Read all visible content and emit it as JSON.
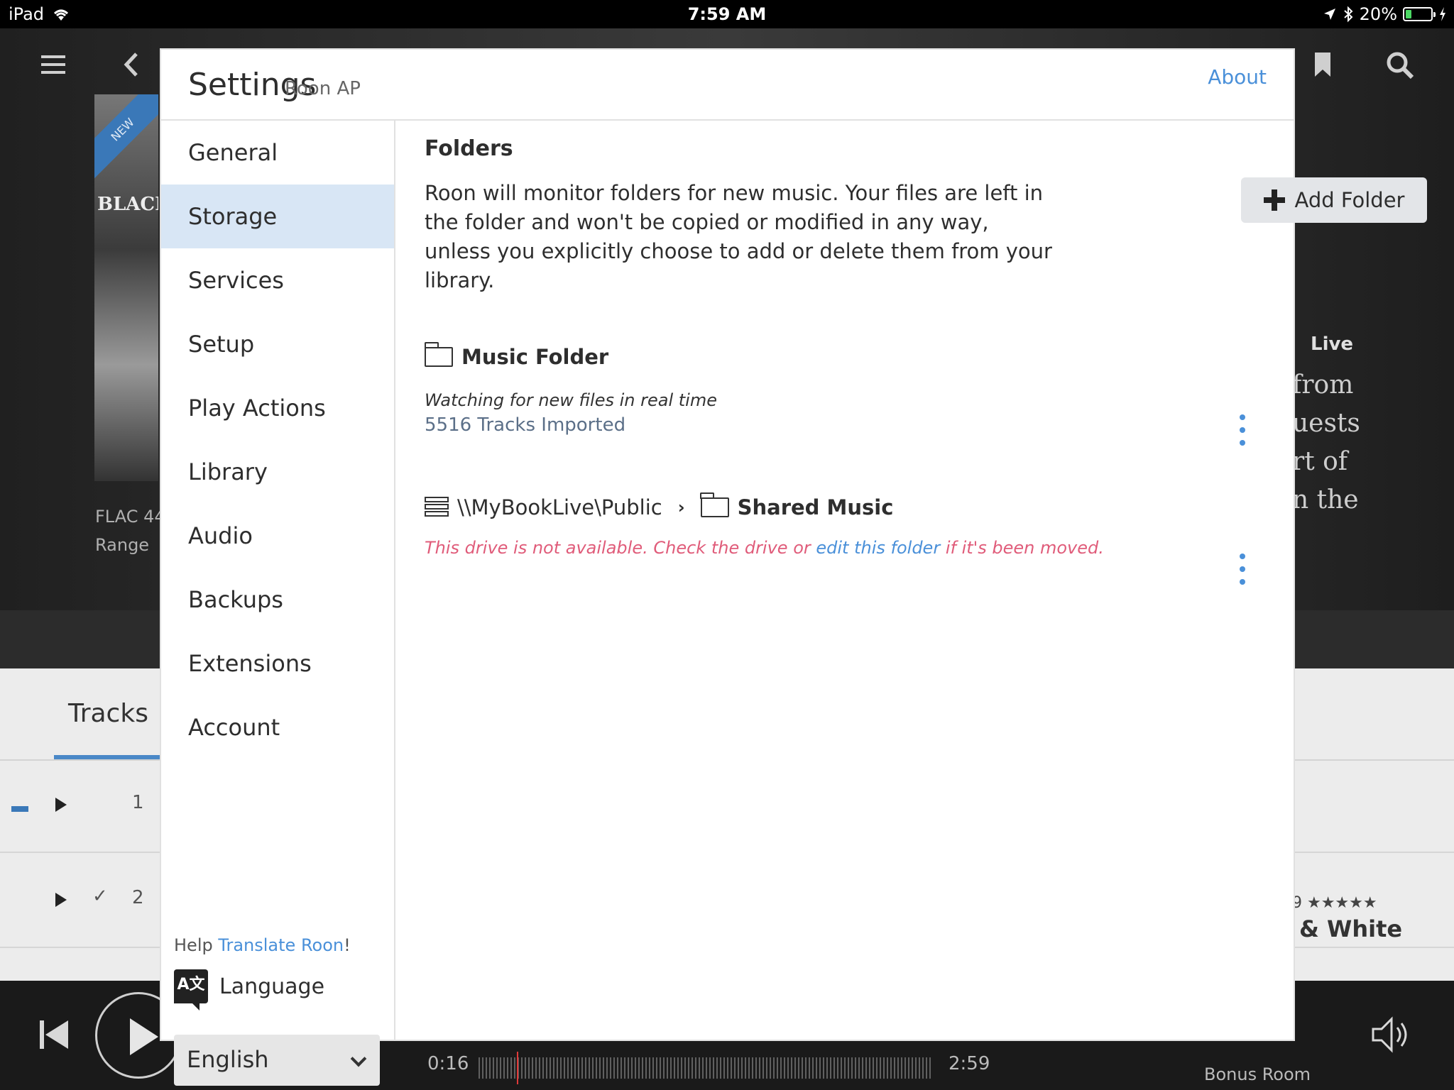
{
  "status_bar": {
    "device": "iPad",
    "time": "7:59 AM",
    "battery": "20%"
  },
  "background_app": {
    "album_badge": "NEW",
    "album_art_text": "BLACK",
    "format_line": "FLAC 44",
    "range_line": "Range",
    "live_label": "Live",
    "right_text": [
      "from",
      "uests",
      "rt  of",
      "n the"
    ],
    "tabs_label": "Tracks",
    "track_rows": [
      {
        "number": "1"
      },
      {
        "number": "2",
        "check": "✓"
      }
    ],
    "stars": "9 ★★★★★",
    "trailing_title": "& White",
    "player": {
      "elapsed": "0:16",
      "duration": "2:59",
      "zone": "Bonus Room"
    }
  },
  "settings": {
    "title": "Settings",
    "subtitle": "Roon AP",
    "about_link": "About",
    "nav": [
      {
        "label": "General",
        "active": false
      },
      {
        "label": "Storage",
        "active": true
      },
      {
        "label": "Services",
        "active": false
      },
      {
        "label": "Setup",
        "active": false
      },
      {
        "label": "Play Actions",
        "active": false
      },
      {
        "label": "Library",
        "active": false
      },
      {
        "label": "Audio",
        "active": false
      },
      {
        "label": "Backups",
        "active": false
      },
      {
        "label": "Extensions",
        "active": false
      },
      {
        "label": "Account",
        "active": false
      }
    ],
    "help": {
      "prefix": "Help ",
      "link": "Translate Roon",
      "suffix": "!"
    },
    "language": {
      "icon_text": "A文",
      "label": "Language",
      "selected": "English"
    },
    "folders": {
      "section_title": "Folders",
      "description": "Roon will monitor folders for new music. Your files are left in the folder and won't be copied or modified in any way, unless you explicitly choose to add or delete them from your library.",
      "add_button": "Add Folder",
      "items": [
        {
          "name": "Music Folder",
          "status": "Watching for new files in real time",
          "count": "5516 Tracks Imported"
        },
        {
          "server": "\\\\MyBookLive\\Public",
          "separator": "›",
          "name": "Shared Music",
          "warning_prefix": "This drive is not available. Check the drive or ",
          "warning_link": "edit this folder",
          "warning_suffix": " if it's been moved."
        }
      ]
    }
  }
}
